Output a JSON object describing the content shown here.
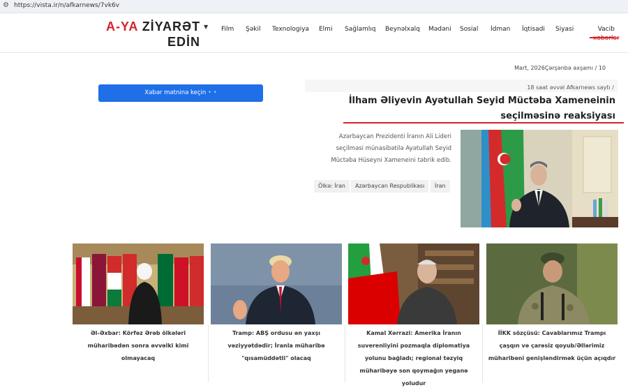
{
  "browser": {
    "url": "https://vista.ir/n/afkarnews/7vk6v"
  },
  "logo": {
    "line1_red": "A-YA",
    "line1_dark": " ZİYARƏT",
    "line2": "EDİN"
  },
  "nav": [
    {
      "label": "Film"
    },
    {
      "label": "Şəkil"
    },
    {
      "label": "Texnologiya"
    },
    {
      "label": "Elmi"
    },
    {
      "label": "Sağlamlıq"
    },
    {
      "label": "Beynəlxalq"
    },
    {
      "label": "Mədəni"
    },
    {
      "label": "Sosial"
    },
    {
      "label": "İdman"
    },
    {
      "label": "İqtisadi"
    },
    {
      "label": "Siyasi"
    }
  ],
  "vacib": {
    "line1": "Vacib",
    "line2": "xəbərlər"
  },
  "date": "Mart, 2026Çərşənbə axşamı / 10",
  "read_button": {
    "label": "Xəbər mətninə keçin",
    "dots": " • •"
  },
  "article": {
    "meta": "18 saat əvvəl Afkarnews saytı /",
    "title": "İlham Əliyevin Ayətullah Seyid Müctəba Xameneinin seçilməsinə reaksiyası",
    "lead": "Azərbaycan Prezidenti İranın Ali Lideri seçilməsi münasibətilə Ayətullah Seyid Müctəba Hüseyni Xameneini təbrik edib.",
    "tags": [
      "Ölkə: İran",
      "Azərbaycan Respublikası",
      "İran"
    ]
  },
  "cards": [
    {
      "caption": "Əl-Əxbar: Körfəz Ərəb ölkələri müharibədən sonra əvvəlki kimi olmayacaq"
    },
    {
      "caption": "Tramp: ABŞ ordusu ən yaxşı vəziyyətdədir; İranla müharibə \"qısamüddətli\" olacaq"
    },
    {
      "caption": "Kamal Xərrazi: Amerika İranın suverenliyini pozmaqla diplomatiya yolunu bağladı; regional təzyiq müharibəyə son qoymağın yeganə yoludur"
    },
    {
      "caption": "İİKK sözçüsü: Cavablarımız Trampı çaşqın və çarəsiz qoyub/Əllərimiz müharibəni genişləndirmək üçün açıqdır"
    }
  ],
  "colors": {
    "accent": "#d1232a",
    "button": "#1e6fe8"
  }
}
